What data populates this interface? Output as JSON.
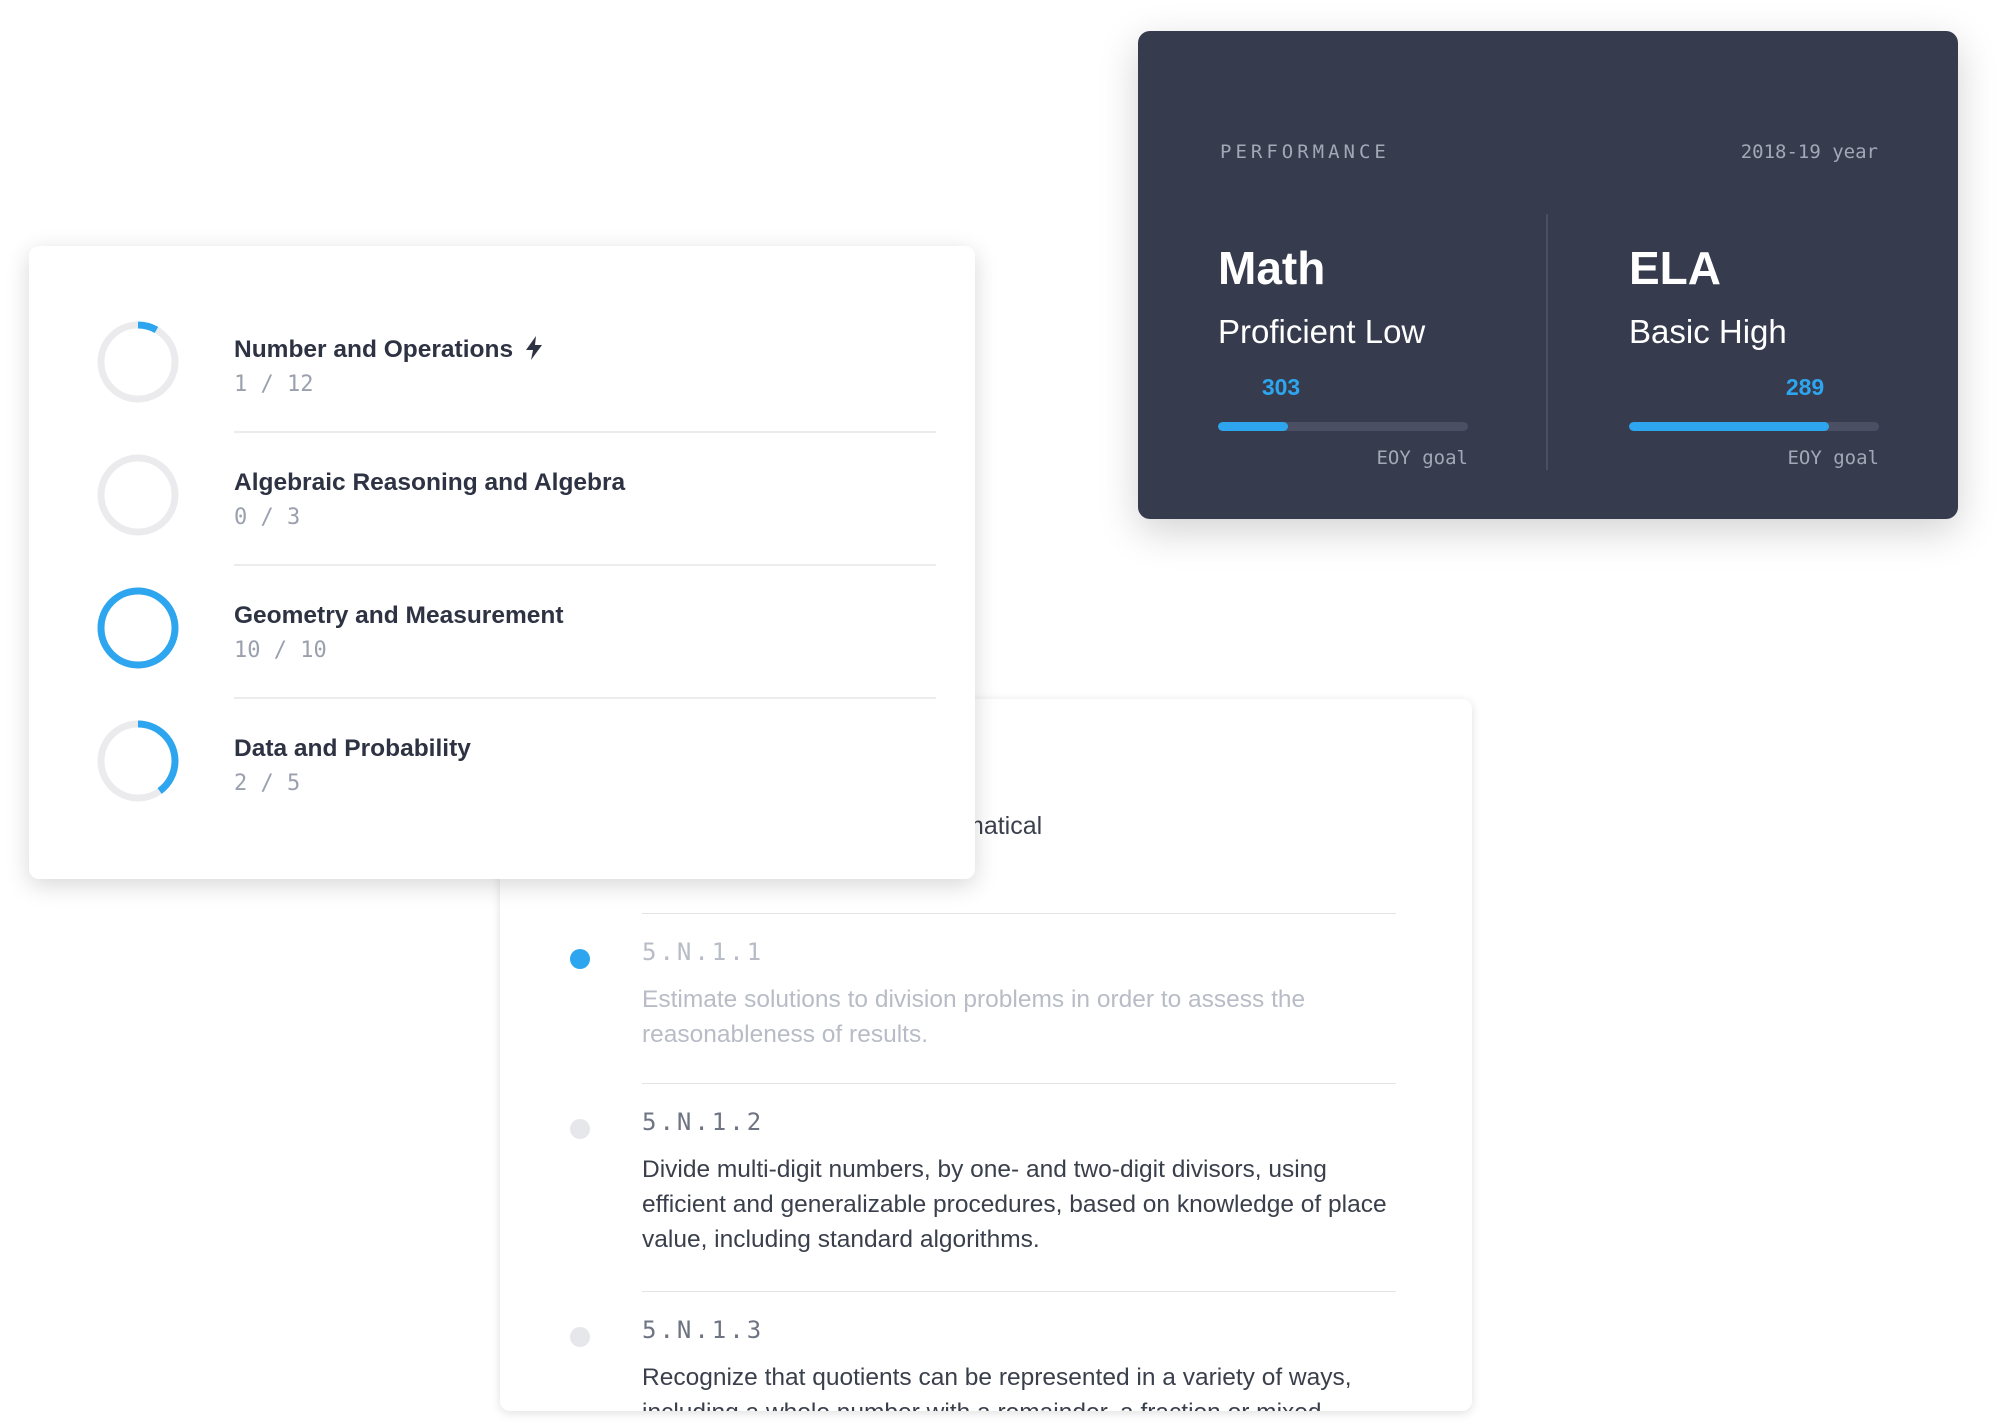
{
  "performance": {
    "eyebrow": "PERFORMANCE",
    "year": "2018-19 year",
    "subjects": [
      {
        "name": "Math",
        "level": "Proficient Low",
        "score": "303",
        "progress": 0.28,
        "goal_label": "EOY goal"
      },
      {
        "name": "ELA",
        "level": "Basic High",
        "score": "289",
        "progress": 0.8,
        "goal_label": "EOY goal"
      }
    ]
  },
  "domains": [
    {
      "title": "Number and Operations",
      "count": "1 / 12",
      "progress": 0.083,
      "flagged": true
    },
    {
      "title": "Algebraic Reasoning and Algebra",
      "count": "0 / 3",
      "progress": 0.0,
      "flagged": false
    },
    {
      "title": "Geometry and Measurement",
      "count": "10 / 10",
      "progress": 1.0,
      "flagged": false
    },
    {
      "title": "Data and Probability",
      "count": "2 / 5",
      "progress": 0.4,
      "flagged": false
    }
  ],
  "standards": {
    "intro": "d solve real-world and mathematical",
    "items": [
      {
        "code": "5.N.1.1",
        "description": "Estimate solutions to division problems in order to assess the reasonableness of results.",
        "active": true
      },
      {
        "code": "5.N.1.2",
        "description": "Divide multi-digit numbers, by one- and two-digit divisors, using efficient and generalizable procedures, based on knowledge of place value, including standard algorithms.",
        "active": false
      },
      {
        "code": "5.N.1.3",
        "description": "Recognize that quotients can be represented in a variety of ways, including a whole number with a remainder, a fraction or mixed",
        "active": false
      }
    ]
  },
  "colors": {
    "accent": "#2da6ef",
    "track_light": "#ebebed",
    "card_dark": "#363b4e"
  },
  "icons": {
    "flag": "lightning-bolt-icon"
  }
}
